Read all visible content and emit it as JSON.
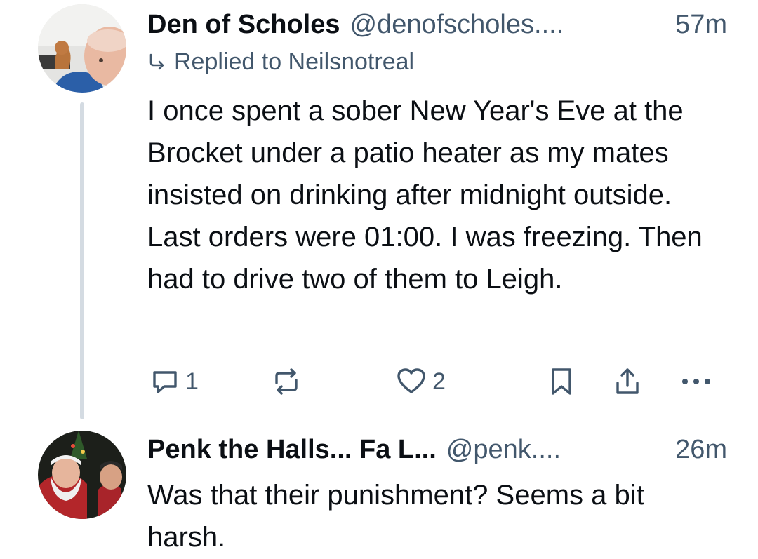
{
  "posts": [
    {
      "author": "Den of Scholes",
      "handle": "@denofscholes....",
      "time": "57m",
      "replied_to": "Replied to Neilsnotreal",
      "text": "I once spent a sober New Year's Eve at the Brocket under a patio heater as my mates insisted on drinking after midnight outside. Last orders were 01:00. I was freezing. Then had to drive two of them to Leigh.",
      "reply_count": "1",
      "like_count": "2"
    },
    {
      "author": "Penk the Halls... Fa L...",
      "handle": "@penk....",
      "time": "26m",
      "text": "Was that their punishment? Seems a bit harsh."
    }
  ],
  "icons": {
    "reply": "speech-bubble-icon",
    "repost": "repost-arrows-icon",
    "like": "heart-outline-icon",
    "bookmark": "bookmark-icon",
    "share": "share-upload-icon",
    "more": "ellipsis-icon"
  },
  "colors": {
    "text_primary": "#0b0f14",
    "text_secondary": "#42576c",
    "thread_line": "#d4dbe2"
  }
}
